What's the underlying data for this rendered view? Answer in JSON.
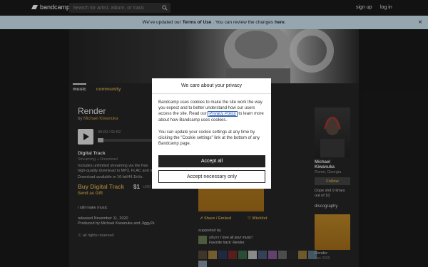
{
  "topbar": {
    "logo": "bandcamp",
    "search_placeholder": "Search for artist, album, or track",
    "signup": "sign up",
    "login": "log in"
  },
  "notice": {
    "prefix": "We've updated our",
    "terms": "Terms of Use",
    "middle": ". You can review the changes",
    "here": "here",
    "suffix": ".",
    "close": "×"
  },
  "tabs": {
    "music": "music",
    "community": "community"
  },
  "album": {
    "title": "Render",
    "by": "by",
    "artist": "Michael Kiwanuka",
    "time": "00:00 / 01:52",
    "digital_track": "Digital Track",
    "digital_sub": "Streaming + Download",
    "digital_desc_1": "Includes unlimited streaming via the free",
    "digital_desc_2": "high-quality download in MP3, FLAC and m",
    "download_avail": "Download available in 16-bit/44.1kHz.",
    "buy": "Buy Digital Track",
    "price": "$1",
    "currency": "USD",
    "gift": "Send as Gift",
    "description": "i still make music",
    "released": "released November 11, 2020",
    "produced": "Produced by Michael Kiwanuka and Jiggy2k",
    "rights": "all rights reserved",
    "share": "Share / Embed",
    "wishlist": "Wishlist",
    "supported_by": "supported by",
    "supporter_name": "gillymr",
    "supporter_quote": "I love all your music!",
    "supporter_fav": "Favorite track: Render."
  },
  "artist": {
    "name_1": "Michael",
    "name_2": "Kiwanuka",
    "location": "Rome, Georgia",
    "follow": "Follow",
    "bio_1": "Dope shit 9 times",
    "bio_2": "out of 10",
    "discography": "discography",
    "disc_title": "Render",
    "disc_date": "Nov 2020"
  },
  "modal": {
    "title": "We care about your privacy",
    "body_pre": "Bandcamp uses cookies to make the site work the way you expect and to better understand how our users access the site. Read our",
    "policy_link": "Privacy Policy",
    "body_post": "to learn more about how Bandcamp uses cookies.",
    "body2": "You can update your cookie settings at any time by clicking the \"Cookie settings\" link at the bottom of any Bandcamp page.",
    "accept_all": "Accept all",
    "accept_necessary": "Accept necessary only"
  },
  "colors": {
    "accent": "#c9a24b",
    "notice_bg": "#cfe6f3",
    "art": "#b6801f"
  },
  "icons": {
    "search": "search-icon",
    "close": "close-icon",
    "heart": "heart-icon",
    "share": "share-icon",
    "play": "play-icon",
    "copyright": "copyright-icon"
  },
  "supporter_thumbs": [
    "#5a4a3a",
    "#a08040",
    "#2a3a5a",
    "#7a2a2a",
    "#3a6a4a",
    "#c0c0c0",
    "#4a5a7a",
    "#8a5a9a",
    "#6a6a6a",
    "#2a2a2a",
    "#9a7a3a",
    "#5a7a8a"
  ]
}
